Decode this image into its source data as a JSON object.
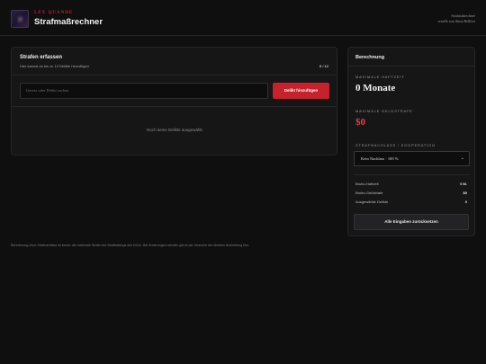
{
  "header": {
    "kicker": "LEX QUANDE",
    "title": "Strafmaßrechner",
    "right_line1": "Strafmaßrechner",
    "right_line2": "erstellt von Akira Bellfort"
  },
  "capture": {
    "title": "Strafen erfassen",
    "subtitle": "Hier kannst du bis zu 12 Delikte hinzufügen",
    "count": "0 / 12",
    "search_placeholder": "Gesetz oder Delikt suchen",
    "add_button": "Delikt hinzufügen",
    "empty_text": "Noch keine Delikte ausgewählt."
  },
  "calc": {
    "title": "Berechnung",
    "max_time_label": "MAXIMALE HAFTZEIT",
    "max_time_value": "0 Monate",
    "max_fine_label": "MAXIMALE GELDSTRAFE",
    "max_fine_value": "$0",
    "discount_label": "STRAFNACHLASS / KOOPERATION",
    "discount_selected": "Kein Nachlass · 100 %",
    "stats": [
      {
        "label": "Brutto-Haftzeit",
        "value": "0 M."
      },
      {
        "label": "Brutto-Geldstrafe",
        "value": "$0"
      },
      {
        "label": "Ausgewählte Delikte",
        "value": "0"
      }
    ],
    "reset_button": "Alle Eingaben zurücksetzen"
  },
  "footer": {
    "note": "Berechnung ohne Strafnachlass ist immer die maximale Strafe des Strafkatalogs des DOJs. Bei Änderungen wenden gerne per Gesuche der direkten Anmeldung hier."
  },
  "colors": {
    "accent": "#c5222b",
    "fine": "#e0434a",
    "background": "#0f0f10",
    "panel": "#161617"
  },
  "icons": {
    "logo": "crest-logo",
    "select_chevron": "chevron-down-icon"
  }
}
